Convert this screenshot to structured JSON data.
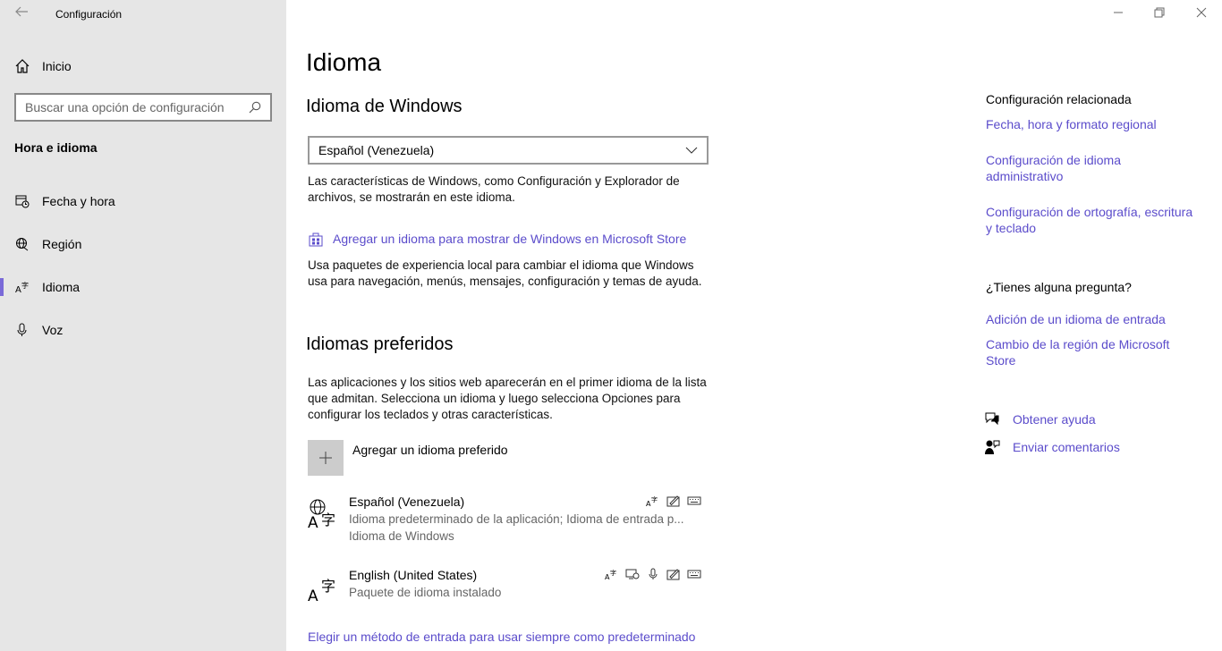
{
  "window": {
    "title": "Configuración",
    "back_icon": "back-arrow-icon",
    "minimize_icon": "minimize-icon",
    "restore_icon": "restore-icon",
    "close_icon": "close-icon"
  },
  "sidebar": {
    "home_label": "Inicio",
    "search_placeholder": "Buscar una opción de configuración",
    "section_title": "Hora e idioma",
    "items": [
      {
        "label": "Fecha y hora",
        "icon": "calendar-clock-icon",
        "selected": false
      },
      {
        "label": "Región",
        "icon": "globe-icon",
        "selected": false
      },
      {
        "label": "Idioma",
        "icon": "language-icon",
        "selected": true
      },
      {
        "label": "Voz",
        "icon": "microphone-icon",
        "selected": false
      }
    ]
  },
  "main": {
    "title": "Idioma",
    "windows_language": {
      "heading": "Idioma de Windows",
      "selected": "Español (Venezuela)",
      "description": "Las características de Windows, como Configuración y Explorador de archivos, se mostrarán en este idioma.",
      "store_link": "Agregar un idioma para mostrar de Windows en Microsoft Store",
      "store_description": "Usa paquetes de experiencia local para cambiar el idioma que Windows usa para navegación, menús, mensajes, configuración y temas de ayuda."
    },
    "preferred": {
      "heading": "Idiomas preferidos",
      "description": "Las aplicaciones y los sitios web aparecerán en el primer idioma de la lista que admitan. Selecciona un idioma y luego selecciona Opciones para configurar los teclados y otras características.",
      "add_label": "Agregar un idioma preferido",
      "languages": [
        {
          "name": "Español (Venezuela)",
          "line1": "Idioma predeterminado de la aplicación; Idioma de entrada p...",
          "line2": "Idioma de Windows"
        },
        {
          "name": "English (United States)",
          "line1": "Paquete de idioma instalado"
        }
      ],
      "bottom_link": "Elegir un método de entrada para usar siempre como predeterminado"
    }
  },
  "related": {
    "title": "Configuración relacionada",
    "links": [
      "Fecha, hora y formato regional",
      "Configuración de idioma administrativo",
      "Configuración de ortografía, escritura y teclado"
    ],
    "question_title": "¿Tienes alguna pregunta?",
    "question_links": [
      "Adición de un idioma de entrada",
      "Cambio de la región de Microsoft Store"
    ],
    "help_label": "Obtener ayuda",
    "feedback_label": "Enviar comentarios"
  },
  "colors": {
    "accent": "#5b4ccb",
    "sidebar_bg": "#e6e6e6",
    "selection_bar": "#7a6ad8"
  }
}
